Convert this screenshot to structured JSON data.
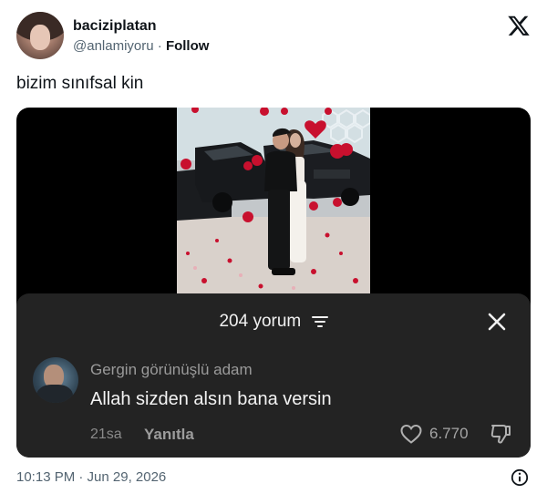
{
  "user": {
    "name": "baciziplatan",
    "handle": "@anlamiyoru",
    "separator": " · ",
    "follow_label": "Follow"
  },
  "tweet": {
    "text": "bizim sınıfsal kin",
    "date": "10:13 PM · Jun 29, 2026"
  },
  "comments_sheet": {
    "count_label": "204 yorum",
    "comment": {
      "author": "Gergin görünüşlü adam",
      "text": "Allah sizden alsın bana versin",
      "age": "21sa",
      "reply_label": "Yanıtla",
      "likes": "6.770"
    }
  },
  "colors": {
    "sheet_bg": "#232323",
    "media_bg": "#000000",
    "balloon_red": "#c8102e",
    "secondary_text": "#536471"
  },
  "icons": [
    "x-logo-icon",
    "filter-icon",
    "close-icon",
    "heart-icon",
    "thumbs-down-icon",
    "info-icon"
  ]
}
